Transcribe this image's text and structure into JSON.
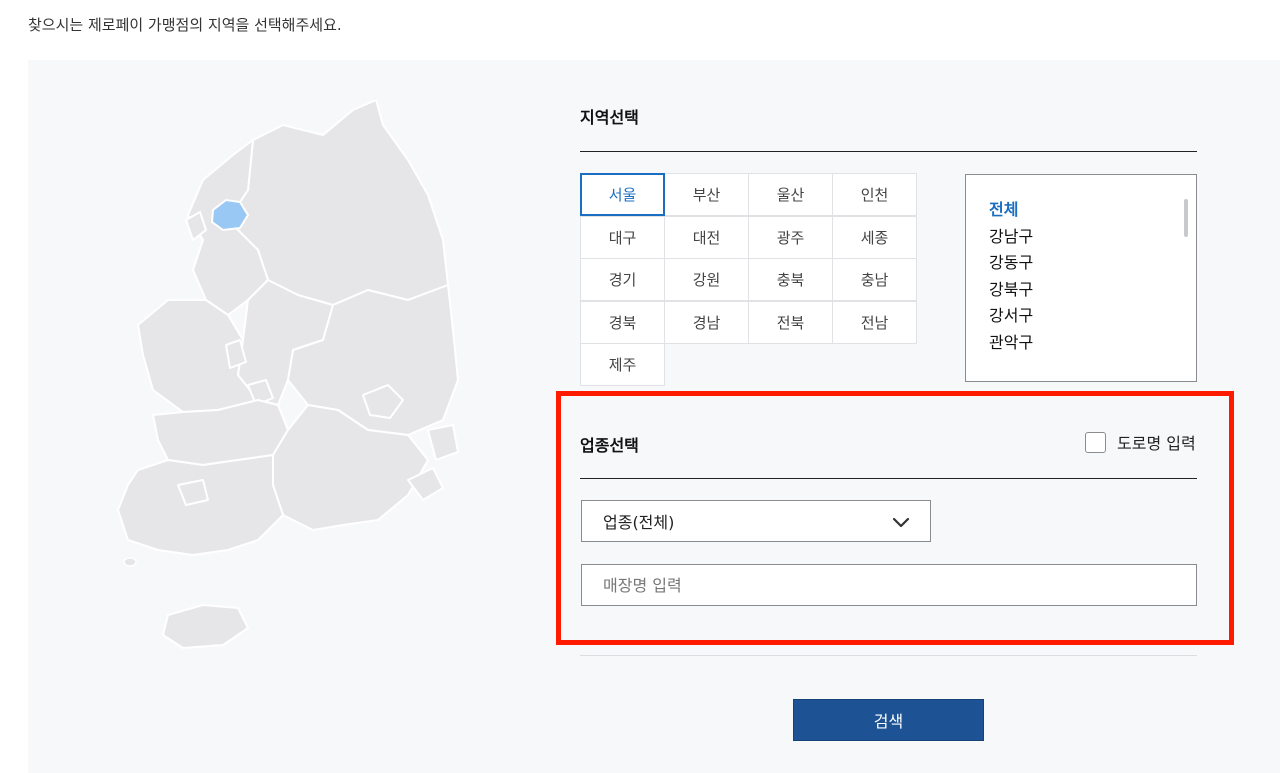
{
  "intro_text": "찾으시는 제로페이 가맹점의 지역을 선택해주세요.",
  "region": {
    "title": "지역선택",
    "cities": [
      "서울",
      "부산",
      "울산",
      "인천",
      "대구",
      "대전",
      "광주",
      "세종",
      "경기",
      "강원",
      "충북",
      "충남",
      "경북",
      "경남",
      "전북",
      "전남",
      "제주"
    ],
    "selected_city": "서울",
    "districts": [
      "전체",
      "강남구",
      "강동구",
      "강북구",
      "강서구",
      "관악구"
    ],
    "selected_district": "전체"
  },
  "business": {
    "title": "업종선택",
    "road_name_label": "도로명 입력",
    "category_select": "업종(전체)",
    "store_placeholder": "매장명 입력"
  },
  "search_button": "검색",
  "colors": {
    "accent": "#1a6fc2",
    "button": "#1d5394",
    "highlight": "#ff1a00",
    "map_selected": "#9ac8f5"
  }
}
